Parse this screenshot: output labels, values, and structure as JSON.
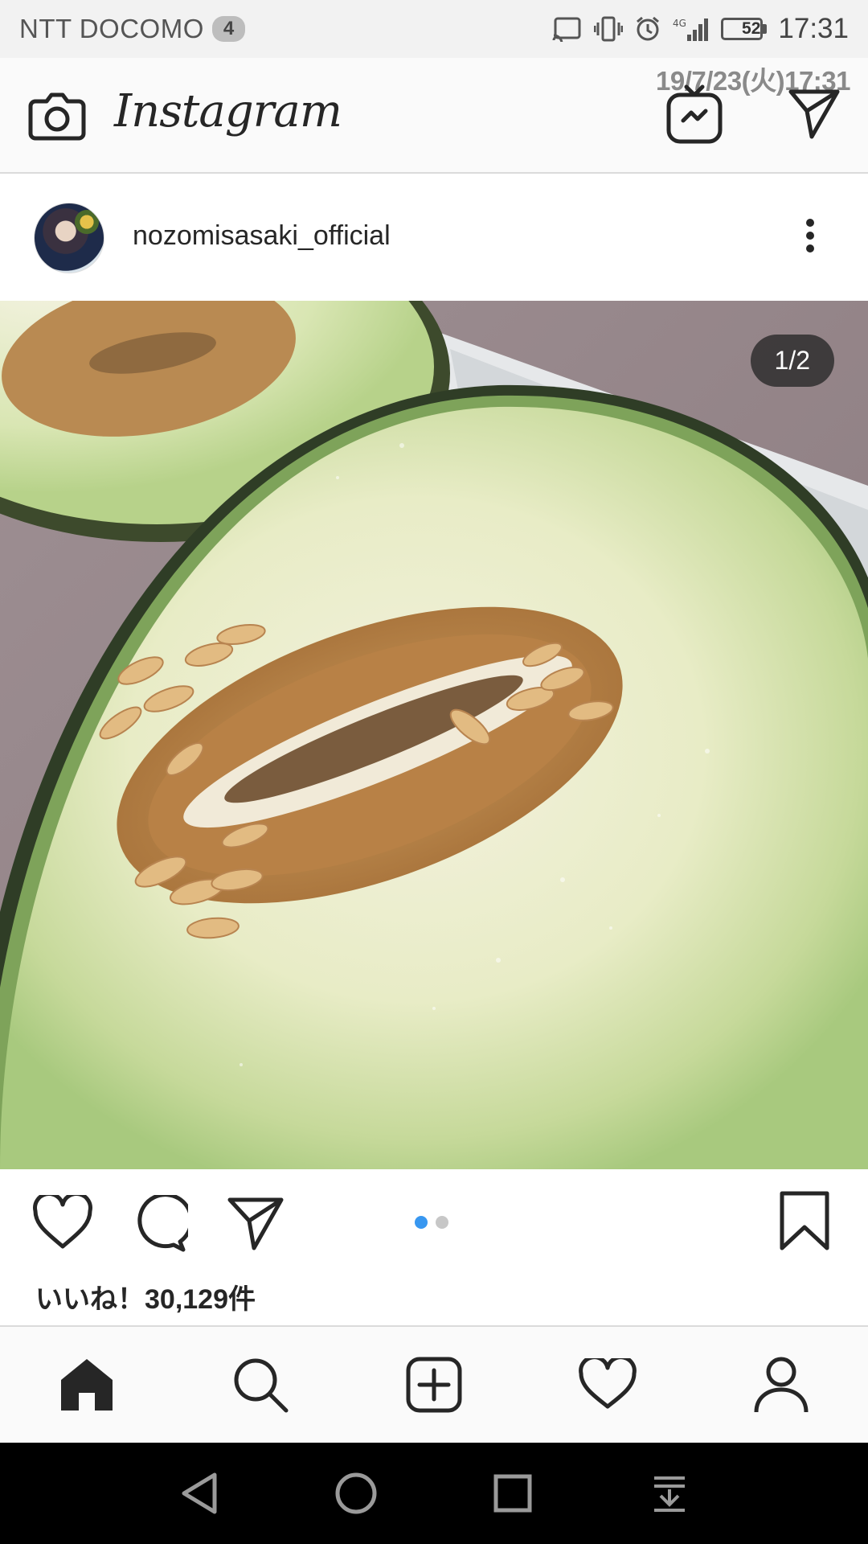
{
  "status_bar": {
    "carrier": "NTT DOCOMO",
    "notification_count": "4",
    "network": "4G",
    "battery_level": "52",
    "time": "17:31"
  },
  "overlay_timestamp": "19/7/23(火)17:31",
  "header": {
    "logo": "Instagram",
    "icons": [
      "camera-icon",
      "igtv-icon",
      "direct-message-icon"
    ]
  },
  "post": {
    "username": "nozomisasaki_official",
    "page_indicator": "1/2",
    "carousel": {
      "total": 2,
      "current": 1
    },
    "likes": "いいね！30,129件",
    "image_description": "halved-melon-photo"
  },
  "bottom_nav": {
    "items": [
      "home-icon",
      "search-icon",
      "add-post-icon",
      "activity-heart-icon",
      "profile-icon"
    ],
    "active": "home-icon"
  },
  "system_nav": [
    "back-icon",
    "home-circle-icon",
    "recents-icon",
    "notification-drawer-icon"
  ],
  "colors": {
    "accent_blue": "#3897f0",
    "text": "#262626",
    "divider": "#dbdbdb"
  }
}
